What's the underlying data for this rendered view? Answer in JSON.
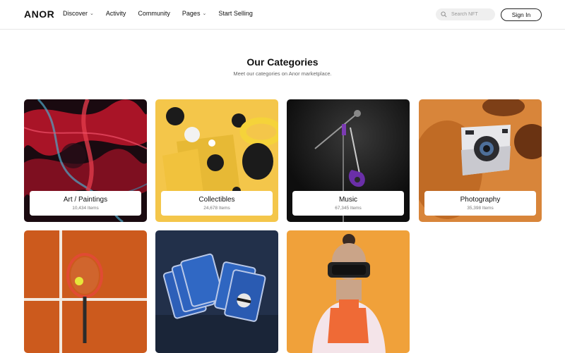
{
  "brand": {
    "logo": "ANOR"
  },
  "nav": {
    "items": [
      {
        "label": "Discover",
        "has_dropdown": true
      },
      {
        "label": "Activity",
        "has_dropdown": false
      },
      {
        "label": "Community",
        "has_dropdown": false
      },
      {
        "label": "Pages",
        "has_dropdown": true
      },
      {
        "label": "Start Selling",
        "has_dropdown": false
      }
    ]
  },
  "search": {
    "placeholder": "Search NFT",
    "icon": "search-icon"
  },
  "auth": {
    "signin_label": "Sign In"
  },
  "section": {
    "title": "Our Categories",
    "subtitle": "Meet our categories on Anor marketplace."
  },
  "categories": [
    {
      "name": "Art / Paintings",
      "count": "10,434 Items"
    },
    {
      "name": "Collectibles",
      "count": "24,678 Items"
    },
    {
      "name": "Music",
      "count": "67,345 Items"
    },
    {
      "name": "Photography",
      "count": "35,398 Items"
    },
    {
      "name": "",
      "count": ""
    },
    {
      "name": "",
      "count": ""
    },
    {
      "name": "",
      "count": ""
    }
  ],
  "colors": {
    "accent": "#111111",
    "search_bg": "#efefef",
    "border": "#e6e6e6"
  }
}
